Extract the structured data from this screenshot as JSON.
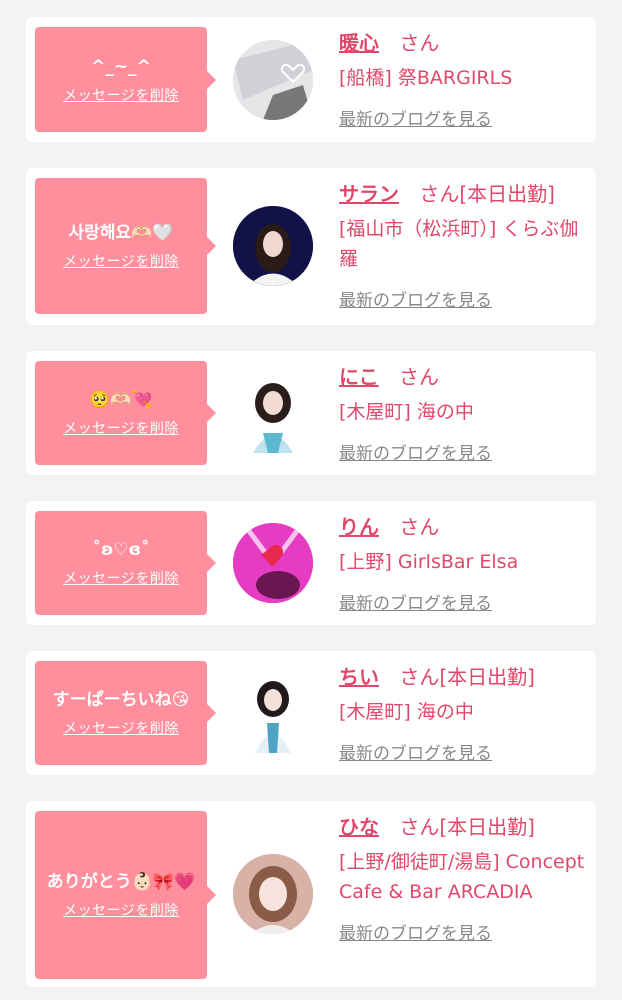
{
  "delete_label": "メッセージを削除",
  "honorific": "さん",
  "blog_label": "最新のブログを見る",
  "cards": [
    {
      "message": "^_~_^",
      "name": "暖心",
      "badge": "",
      "shop": "[船橋] 祭BARGIRLS"
    },
    {
      "message": "사랑해요🫶🏻🤍",
      "name": "サラン",
      "badge": "[本日出勤]",
      "shop": "[福山市（松浜町）] くらぶ伽羅"
    },
    {
      "message": "🥺🫶🏻💘",
      "name": "にこ",
      "badge": "",
      "shop": "[木屋町] 海の中"
    },
    {
      "message": "˚ʚ♡ɞ˚",
      "name": "りん",
      "badge": "",
      "shop": "[上野] GirlsBar Elsa"
    },
    {
      "message": "すーぱーちいね😘",
      "name": "ちい",
      "badge": "[本日出勤]",
      "shop": "[木屋町] 海の中"
    },
    {
      "message": "ありがとう👶🏻🎀💗",
      "name": "ひな",
      "badge": "[本日出勤]",
      "shop": "[上野/御徒町/湯島] Concept Cafe & Bar ARCADIA"
    }
  ]
}
